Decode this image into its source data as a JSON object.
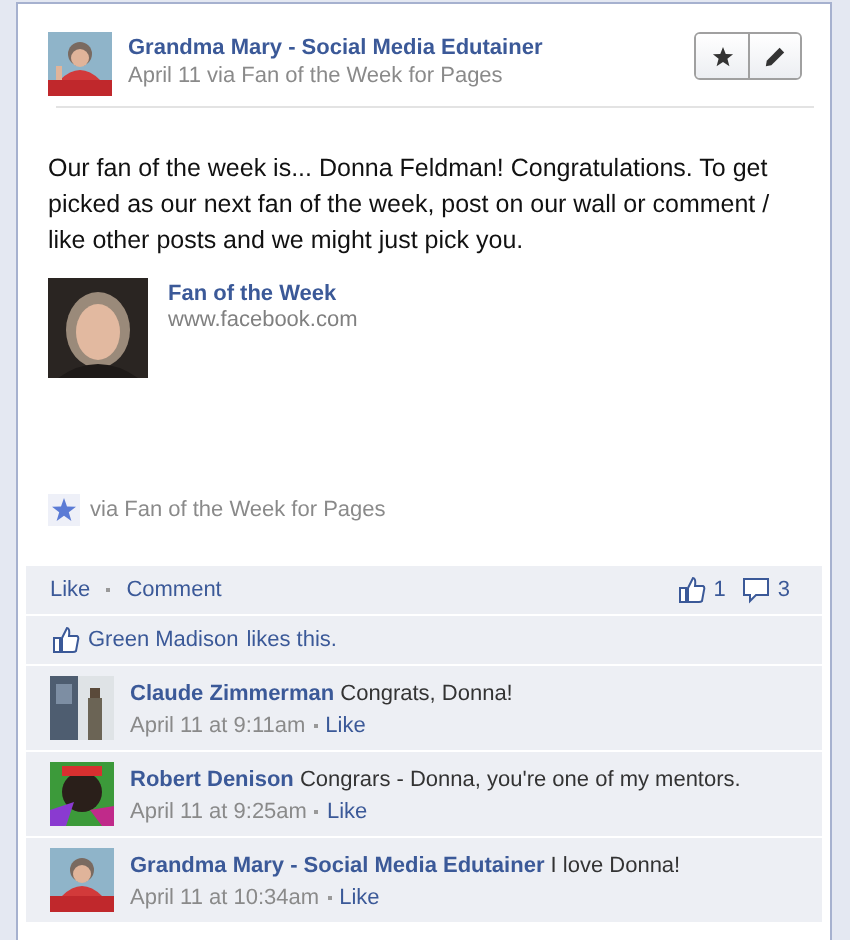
{
  "post": {
    "author": "Grandma Mary - Social Media Edutainer",
    "meta": "April 11 via Fan of the Week for Pages",
    "text": "Our fan of the week is... Donna Feldman! Congratulations. To get picked as our next fan of the week, post on our wall or comment / like other posts and we might just pick you.",
    "attachment": {
      "title": "Fan of the Week",
      "url": "www.facebook.com"
    },
    "via": "via Fan of the Week for Pages"
  },
  "actions": [
    {
      "label": "Like"
    },
    {
      "label": "Comment"
    }
  ],
  "counts": {
    "likes": "1",
    "comments": "3"
  },
  "likes_line": {
    "name": "Green Madison",
    "text": "likes this."
  },
  "comments": [
    {
      "author": "Claude Zimmerman",
      "text": "Congrats, Donna!",
      "time": "April 11 at 9:11am",
      "like": "Like"
    },
    {
      "author": "Robert Denison",
      "text": "Congrars - Donna, you're one of my mentors.",
      "time": "April 11 at 9:25am",
      "like": "Like"
    },
    {
      "author": "Grandma Mary - Social Media Edutainer",
      "text": "I love Donna!",
      "time": "April 11 at 10:34am",
      "like": "Like"
    }
  ]
}
